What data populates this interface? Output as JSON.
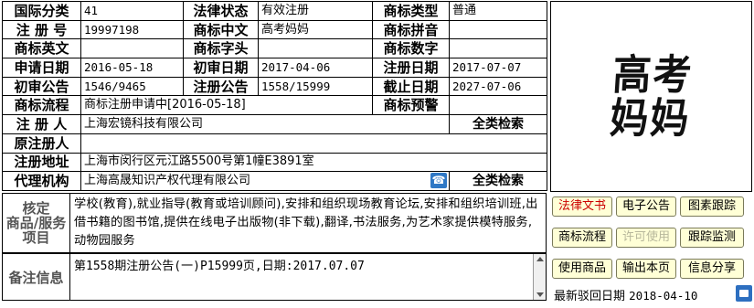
{
  "rows": {
    "intl_class": {
      "label": "国际分类",
      "value": "41"
    },
    "legal_status": {
      "label": "法律状态",
      "value": "有效注册"
    },
    "tm_type": {
      "label": "商标类型",
      "value": "普通"
    },
    "reg_no": {
      "label": "注 册 号",
      "value": "19997198"
    },
    "tm_cn": {
      "label": "商标中文",
      "value": "高考妈妈"
    },
    "tm_pinyin": {
      "label": "商标拼音",
      "value": ""
    },
    "tm_en": {
      "label": "商标英文",
      "value": ""
    },
    "tm_initials": {
      "label": "商标字头",
      "value": ""
    },
    "tm_digits": {
      "label": "商标数字",
      "value": ""
    },
    "apply_date": {
      "label": "申请日期",
      "value": "2016-05-18"
    },
    "prelim_date": {
      "label": "初审日期",
      "value": "2017-04-06"
    },
    "reg_date": {
      "label": "注册日期",
      "value": "2017-07-07"
    },
    "prelim_notice": {
      "label": "初审公告",
      "value": "1546/9465"
    },
    "reg_notice": {
      "label": "注册公告",
      "value": "1558/15999"
    },
    "expiry_date": {
      "label": "截止日期",
      "value": "2027-07-06"
    },
    "process": {
      "label": "商标流程",
      "value": "商标注册申请中[2016-05-18]"
    },
    "warning": {
      "label": "商标预警",
      "value": ""
    },
    "registrant": {
      "label": "注 册 人",
      "value": "上海宏镜科技有限公司"
    },
    "orig_registrant": {
      "label": "原注册人",
      "value": ""
    },
    "address": {
      "label": "注册地址",
      "value": "上海市闵行区元江路5500号第1幢E3891室"
    },
    "agent": {
      "label": "代理机构",
      "value": "上海高晟知识产权代理有限公司"
    }
  },
  "all_class_search": "全类检索",
  "logo": {
    "line1": "高考",
    "line2": "妈妈"
  },
  "goods": {
    "label_lines": [
      "核定",
      "商品/服务",
      "项目"
    ],
    "text": "学校(教育),就业指导(教育或培训顾问),安排和组织现场教育论坛,安排和组织培训班,出借书籍的图书馆,提供在线电子出版物(非下载),翻译,书法服务,为艺术家提供模特服务,动物园服务"
  },
  "notes": {
    "label": "备注信息",
    "text": "第1558期注册公告(一)P15999页,日期:2017.07.07"
  },
  "buttons": {
    "legal_docs": "法律文书",
    "e_notice": "电子公告",
    "image_track": "图素跟踪",
    "tm_process": "商标流程",
    "license": "许可使用",
    "track_monitor": "跟踪监测",
    "use_goods": "使用商品",
    "export_page": "输出本页",
    "share_info": "信息分享"
  },
  "latest_reject": {
    "label": "最新驳回日期",
    "date": "2018-04-10"
  }
}
